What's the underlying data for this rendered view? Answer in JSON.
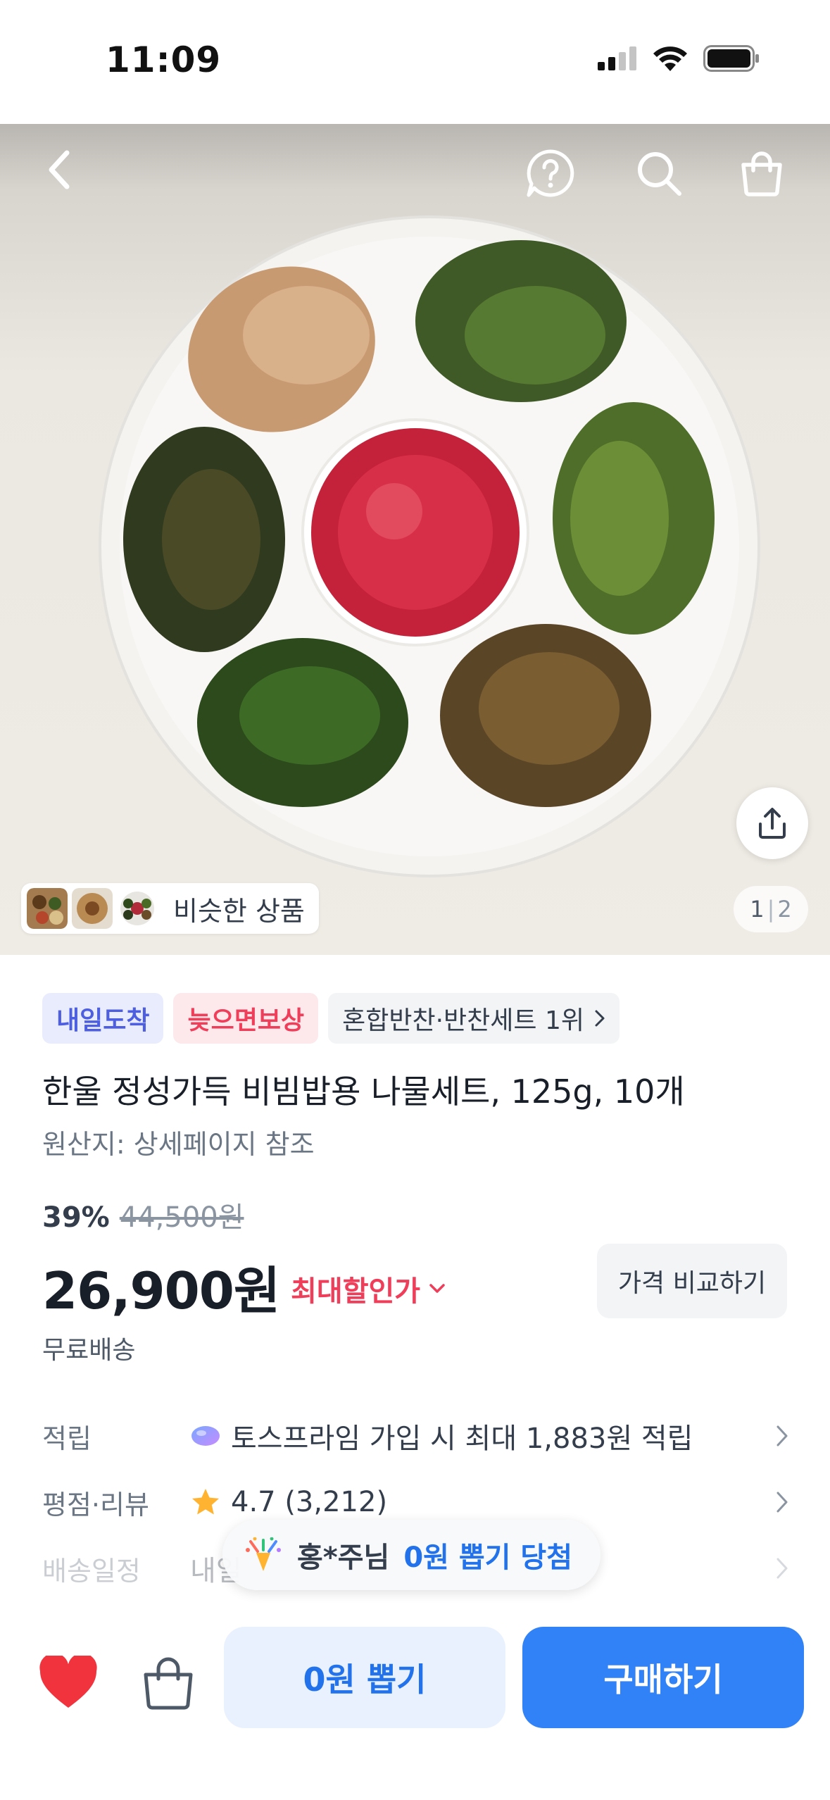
{
  "status_bar": {
    "time": "11:09"
  },
  "header": {
    "back_icon": "chevron-left-icon",
    "help_icon": "question-circle-icon",
    "search_icon": "search-icon",
    "cart_icon": "shopping-bag-icon"
  },
  "gallery": {
    "similar_label": "비슷한 상품",
    "page_current": "1",
    "page_separator": "|",
    "page_total": "2",
    "share_icon": "share-icon"
  },
  "product": {
    "tags": {
      "delivery": "내일도착",
      "compensation": "늦으면보상",
      "ranking": "혼합반찬·반찬세트 1위"
    },
    "title": "한울 정성가득 비빔밥용 나물세트, 125g, 10개",
    "origin": "원산지: 상세페이지 참조",
    "discount": "39%",
    "original_price": "44,500원",
    "sale_price": "26,900원",
    "max_discount_label": "최대할인가",
    "compare_button": "가격 비교하기",
    "shipping": "무료배송"
  },
  "rows": {
    "points_label": "적립",
    "points_value": "토스프라임 가입 시 최대 1,883원 적립",
    "rating_label": "평점·리뷰",
    "rating_value": "4.7 (3,212)",
    "delivery_label": "배송일정",
    "delivery_value": "내일"
  },
  "toast": {
    "name": "홍*주님",
    "message": "0원 뽑기 당첨"
  },
  "bottom_bar": {
    "draw_button": "0원 뽑기",
    "buy_button": "구매하기"
  },
  "colors": {
    "primary": "#3182f6",
    "accent_red": "#ef3e5a",
    "heart": "#f0333d",
    "tag_blue": "#4d5fe0"
  }
}
